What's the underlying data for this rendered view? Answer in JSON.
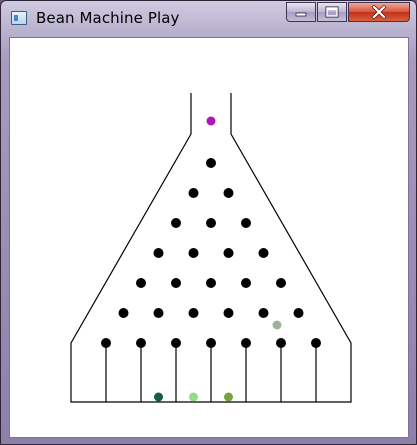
{
  "window": {
    "title": "Bean Machine Play",
    "controls": {
      "minimize_icon": "minimize-icon",
      "maximize_icon": "maximize-icon",
      "close_icon": "close-icon"
    }
  },
  "colors": {
    "peg": "#000000",
    "outline": "#000000",
    "background": "#ffffff",
    "falling_ball": "#b117b8",
    "moving_ball": "#9fb29c"
  },
  "board": {
    "peg_rows": 7,
    "slots": 8
  },
  "balls": [
    {
      "name": "falling-ball",
      "color": "#b117b8"
    },
    {
      "name": "moving-ball",
      "color": "#9fb29c"
    },
    {
      "name": "slot-ball-2",
      "slot": 2,
      "color": "#1a5c3c"
    },
    {
      "name": "slot-ball-3",
      "slot": 3,
      "color": "#94dc84"
    },
    {
      "name": "slot-ball-4",
      "slot": 4,
      "color": "#74a440"
    }
  ]
}
